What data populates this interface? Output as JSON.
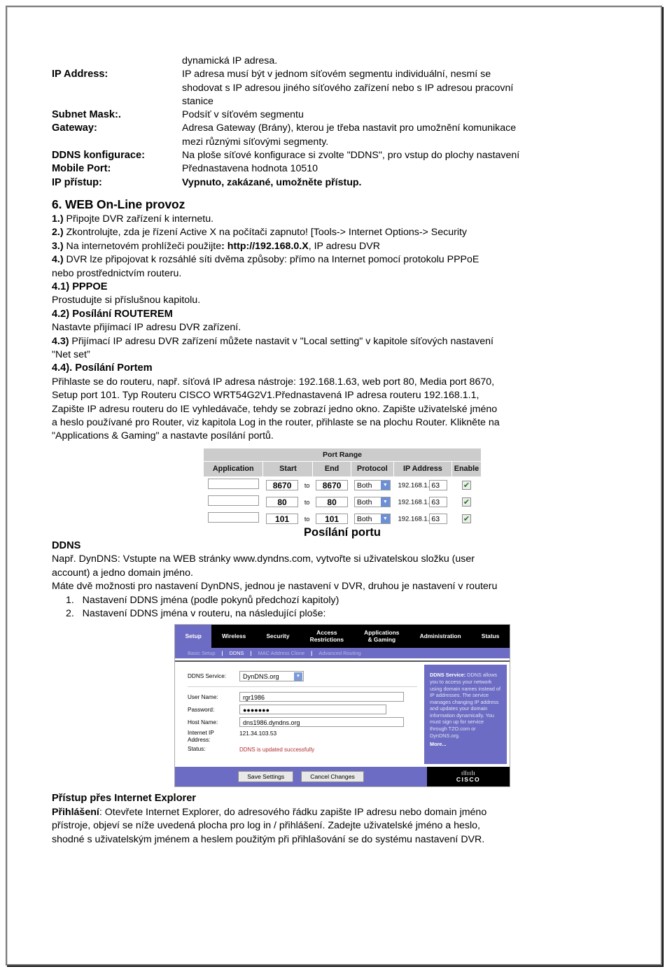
{
  "definitions": [
    {
      "term": "",
      "desc": "dynamická IP adresa."
    },
    {
      "term": "IP Address:",
      "desc": "IP adresa musí být v jednom síťovém segmentu individuální, nesmí se",
      "cont": [
        "shodovat s IP adresou jiného síťového zařízení nebo s IP adresou pracovní",
        "stanice"
      ]
    },
    {
      "term": "Subnet Mask:.",
      "desc": "Podsíť v síťovém segmentu"
    },
    {
      "term": "Gateway:",
      "desc": "Adresa Gateway (Brány), kterou je třeba nastavit pro umožnění komunikace",
      "cont": [
        "mezi různými síťovými segmenty."
      ]
    },
    {
      "term": "DDNS konfigurace:",
      "desc": "Na ploše síťové konfigurace si zvolte \"DDNS\", pro vstup do plochy nastavení"
    },
    {
      "term": "Mobile Port:",
      "desc": "Přednastavena hodnota 10510"
    },
    {
      "term": "IP přístup:",
      "desc": "Vypnuto, zakázané, umožněte přístup.",
      "bold": true
    }
  ],
  "section6": {
    "heading": "6. WEB On-Line provoz",
    "items": [
      {
        "num": "1.)",
        "text": " Připojte DVR zařízení k internetu."
      },
      {
        "num": "2.)",
        "text": " Zkontrolujte, zda je řízení Active X na počítači zapnuto! [Tools-> Internet Options-> Security"
      },
      {
        "num": "3.)",
        "text": " Na internetovém prohlížeči použijte",
        "bold_part": ": http://192.168.0.X",
        "tail": ", IP adresu DVR"
      },
      {
        "num": "4.)",
        "text": " DVR lze připojovat k rozsáhlé síti dvěma způsoby: přímo na Internet pomocí protokolu PPPoE"
      }
    ],
    "item4_cont": "nebo prostřednictvím routeru.",
    "sub41_head": "4.1) PPPOE",
    "sub41_body": "Prostudujte si příslušnou kapitolu.",
    "sub42_head": "4.2) Posílání ROUTEREM",
    "sub42_body": "Nastavte přijímací IP adresu DVR zařízení.",
    "sub43_num": "4.3)",
    "sub43_body": " Přijímací IP adresu DVR zařízení můžete nastavit v \"Local setting\" v kapitole síťových nastavení",
    "sub43_cont": "\"Net set”",
    "sub44_head": "4.4). Posílání Portem",
    "sub44_lines": [
      "Přihlaste se do routeru, např. síťová IP adresa nástroje: 192.168.1.63, web port 80, Media port 8670,",
      "Setup port 101. Typ Routeru CISCO WRT54G2V1.Přednastavená IP adresa routeru 192.168.1.1,",
      "Zapište IP adresu routeru do IE vyhledávače, tehdy se zobrazí jedno okno. Zapište uživatelské jméno",
      "a heslo používané pro Router, viz kapitola Log in the router, přihlaste se na plochu Router. Klikněte na",
      "\"Applications & Gaming\" a nastavte posílání portů."
    ]
  },
  "port_table": {
    "group_header": "Port Range",
    "columns": [
      "Application",
      "Start",
      "End",
      "Protocol",
      "IP Address",
      "Enable"
    ],
    "to_label": "to",
    "ip_prefix": "192.168.1.",
    "check_glyph": "✔",
    "arrow_glyph": "▼",
    "rows": [
      {
        "application": "",
        "start": "8670",
        "end": "8670",
        "protocol": "Both",
        "ip_octet": "63",
        "enable": true
      },
      {
        "application": "",
        "start": "80",
        "end": "80",
        "protocol": "Both",
        "ip_octet": "63",
        "enable": true
      },
      {
        "application": "",
        "start": "101",
        "end": "101",
        "protocol": "Both",
        "ip_octet": "63",
        "enable": true
      }
    ],
    "caption": "Posílání portu"
  },
  "ddns_section": {
    "heading": "DDNS",
    "lines": [
      "Např. DynDNS: Vstupte na WEB stránky www.dyndns.com, vytvořte si uživatelskou složku (user",
      "account) a jedno domain jméno.",
      "Máte dvě možnosti pro nastavení DynDNS, jednou je nastavení v DVR, druhou je nastavení v routeru"
    ],
    "list": [
      {
        "num": "1.",
        "text": "Nastavení DDNS jména (podle pokynů předchozí kapitoly)"
      },
      {
        "num": "2.",
        "text": "Nastavení DDNS jména v routeru, na následující ploše:"
      }
    ]
  },
  "router_ui": {
    "nav_tabs": [
      {
        "label": "Setup",
        "active": true
      },
      {
        "label": "Wireless",
        "active": false
      },
      {
        "label": "Security",
        "active": false
      },
      {
        "label": "Access\nRestrictions",
        "active": false
      },
      {
        "label": "Applications\n& Gaming",
        "active": false
      },
      {
        "label": "Administration",
        "active": false
      },
      {
        "label": "Status",
        "active": false
      }
    ],
    "subnav": [
      {
        "label": "Basic Setup",
        "on": false
      },
      {
        "label": "DDNS",
        "on": true
      },
      {
        "label": "MAC Address Clone",
        "on": false
      },
      {
        "label": "Advanced Routing",
        "on": false
      }
    ],
    "subnav_sep": "|",
    "fields": {
      "ddns_service_label": "DDNS Service:",
      "ddns_service_value": "DynDNS.org",
      "username_label": "User Name:",
      "username_value": "rgr1986",
      "password_label": "Password:",
      "password_value": "●●●●●●●",
      "hostname_label": "Host Name:",
      "hostname_value": "dns1986.dyndns.org",
      "internet_ip_label": "Internet IP\nAddress:",
      "internet_ip_value": "121.34.103.53",
      "status_label": "Status:",
      "status_value": "DDNS is updated successfully"
    },
    "help": {
      "title": "DDNS Service:",
      "text": " DDNS allows you to access your network using domain names instead of IP addresses. The service manages changing IP address and updates your domain information dynamically. You must sign up for service through TZO.com or DynDNS.org.",
      "more": "More..."
    },
    "buttons": {
      "save": "Save Settings",
      "cancel": "Cancel Changes"
    },
    "brand": {
      "bars": "ıllıılı",
      "name": "CISCO"
    },
    "select_arrow": "▼"
  },
  "footer": {
    "heading": "Přístup přes Internet Explorer",
    "login_label": "Přihlášení",
    "lines": [
      ": Otevřete Internet Explorer, do adresového řádku zapište IP adresu nebo domain jméno",
      "přístroje, objeví se níže uvedená plocha pro log in / přihlášení. Zadejte uživatelské jméno a heslo,",
      "shodné s uživatelským jménem a heslem použitým při přihlašování se do systému nastavení DVR."
    ]
  }
}
